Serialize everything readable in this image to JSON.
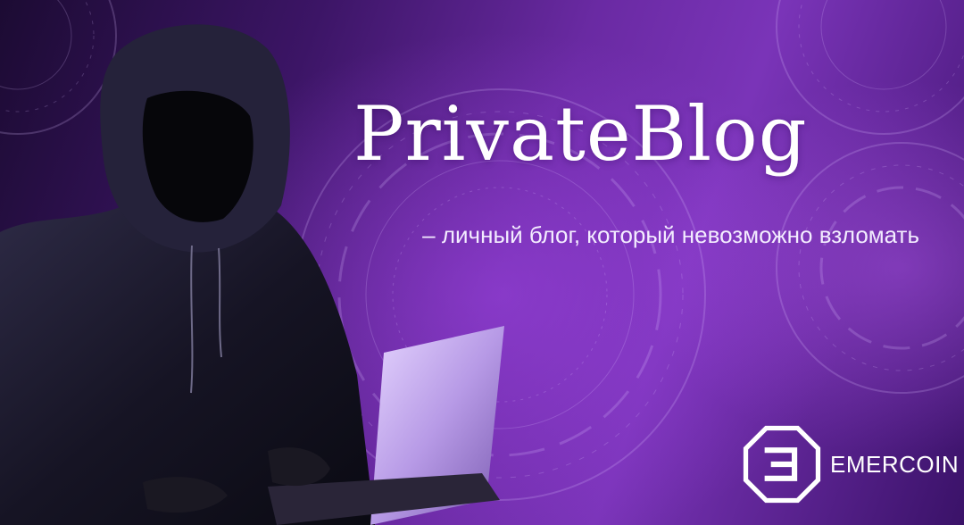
{
  "banner": {
    "title": "PrivateBlog",
    "subtitle": "– личный блог, который невозможно взломать",
    "logo_text": "EMERCOIN"
  },
  "colors": {
    "background_dark": "#1c0b33",
    "background_purple": "#7a34b8",
    "text": "#ffffff"
  },
  "icons": [
    "hooded-figure-image",
    "laptop-image",
    "emercoin-logo-icon"
  ]
}
